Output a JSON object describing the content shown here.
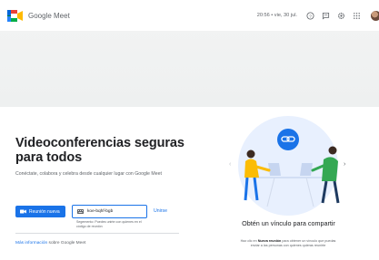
{
  "header": {
    "app_name": "Google Meet",
    "datetime": "20:56 • vie, 30 jul.",
    "icons": [
      "help-icon",
      "feedback-icon",
      "settings-icon",
      "apps-grid-icon",
      "avatar"
    ]
  },
  "hero": {
    "title": "Videoconferencias seguras para todos",
    "subtitle": "Conéctate, colabora y celebra desde cualquier lugar con Google Meet",
    "new_meeting_label": "Reunión nueva",
    "code_input_value": "koe-bqhf-bgb",
    "code_hint": "Segemento: Puedes unirte con quienes en el código de reunión",
    "join_label": "Unirse",
    "more_info_link": "Más información",
    "more_info_suffix": "sobre Google Meet"
  },
  "carousel": {
    "card_title": "Obtén un vínculo para compartir",
    "card_desc_prefix": "Haz clic en",
    "card_desc_bold": "Nueva reunión",
    "card_desc_suffix": "para obtener un vínculo que puedas enviar a las personas con quienes quieras reunirte",
    "prev_icon": "chevron-left-icon",
    "next_icon": "chevron-right-icon"
  },
  "colors": {
    "accent": "#1a73e8",
    "illustration_bg": "#e8f0fe"
  }
}
